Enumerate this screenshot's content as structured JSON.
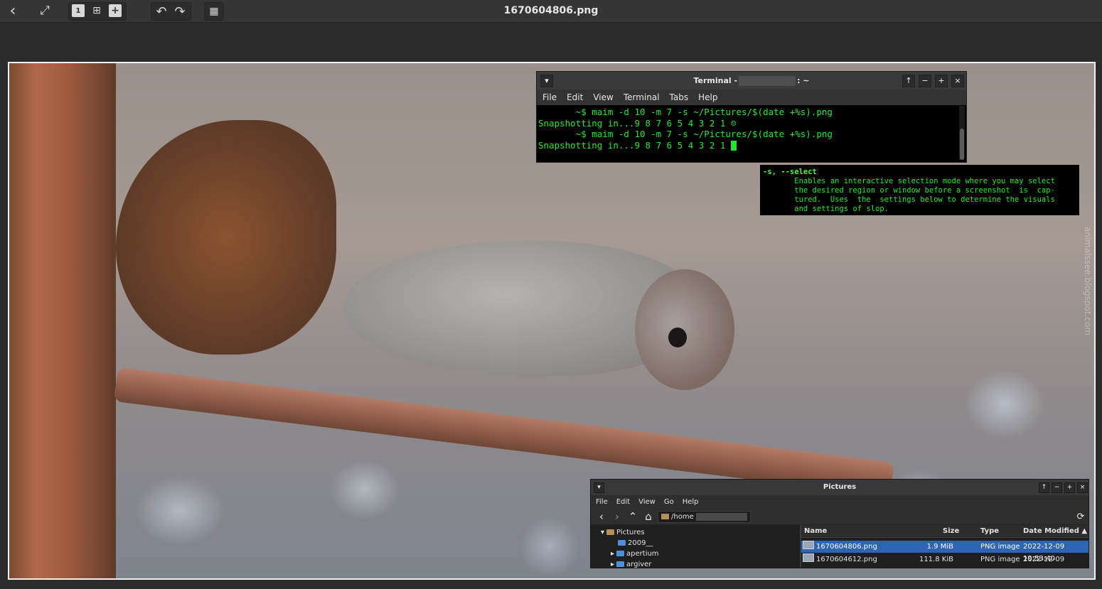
{
  "viewer": {
    "title": "1670604806.png",
    "watermark": "animalssee.blogspot.com"
  },
  "toolbar": {
    "back_icon": "‹",
    "fullscreen_icon": "⤢",
    "zoom_actual_icon": "1",
    "zoom_fit_icon": "⊞",
    "zoom_in_icon": "+",
    "rotate_left_icon": "↶",
    "rotate_right_icon": "↷",
    "checker_icon": "▦"
  },
  "terminal": {
    "title_prefix": "Terminal -",
    "title_suffix": ": ~",
    "menu": [
      "File",
      "Edit",
      "View",
      "Terminal",
      "Tabs",
      "Help"
    ],
    "lines": [
      "       ~$ maim -d 10 -m 7 -s ~/Pictures/$(date +%s).png",
      "Snapshotting in...9 8 7 6 5 4 3 2 1 ☺",
      "       ~$ maim -d 10 -m 7 -s ~/Pictures/$(date +%s).png",
      "Snapshotting in...9 8 7 6 5 4 3 2 1 "
    ],
    "buttons": {
      "menu": "▾",
      "up": "↑",
      "minimize": "−",
      "maximize": "+",
      "close": "×"
    }
  },
  "manpage": {
    "option": "-s, --select",
    "lines": [
      "       Enables an interactive selection mode where you may select",
      "       the desired region or window before a screenshot  is  cap-",
      "       tured.  Uses  the  settings below to determine the visuals",
      "       and settings of slop."
    ]
  },
  "file_manager": {
    "title": "Pictures",
    "menu": [
      "File",
      "Edit",
      "View",
      "Go",
      "Help"
    ],
    "path": "/home",
    "buttons": {
      "menu": "▾",
      "up": "↑",
      "minimize": "−",
      "maximize": "+",
      "close": "×"
    },
    "nav": {
      "back": "‹",
      "forward": "›",
      "up": "⌃",
      "home": "⌂",
      "refresh": "⟳"
    },
    "tree": [
      {
        "label": "Pictures",
        "expander": "▾"
      },
      {
        "label": "2009__",
        "expander": ""
      },
      {
        "label": "apertium",
        "expander": "▸"
      },
      {
        "label": "argiver",
        "expander": "▸"
      }
    ],
    "columns": [
      "Name",
      "Size",
      "Type",
      "Date Modified ▲"
    ],
    "files": [
      {
        "name": "1670604806.png",
        "size": "1.9  MiB",
        "type": "PNG image",
        "date": "2022-12-09 19:53:40",
        "selected": true
      },
      {
        "name": "1670604612.png",
        "size": "111.8  KiB",
        "type": "PNG image",
        "date": "2022-12-09 19:50:25",
        "selected": false
      }
    ]
  }
}
